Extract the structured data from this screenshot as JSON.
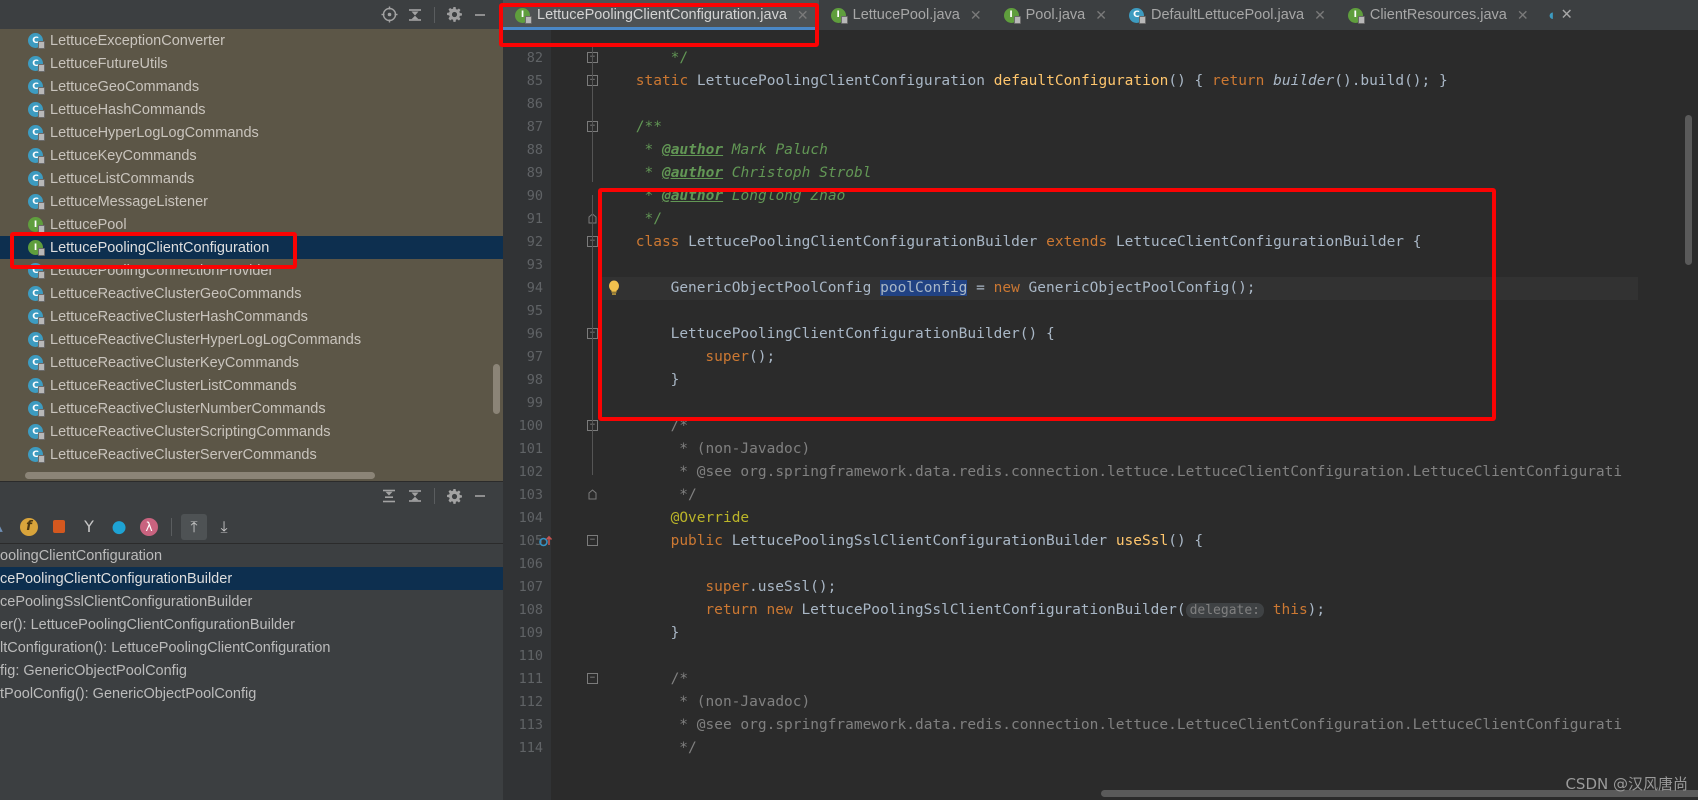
{
  "project_panel": {
    "toolbar": {
      "locate_icon": "target-icon",
      "collapse_icon": "collapse-all-icon",
      "settings_icon": "gear-icon",
      "hide_icon": "minimize-icon"
    },
    "items": [
      {
        "label": "LettuceExceptionConverter",
        "kind": "class"
      },
      {
        "label": "LettuceFutureUtils",
        "kind": "class"
      },
      {
        "label": "LettuceGeoCommands",
        "kind": "class"
      },
      {
        "label": "LettuceHashCommands",
        "kind": "class"
      },
      {
        "label": "LettuceHyperLogLogCommands",
        "kind": "class"
      },
      {
        "label": "LettuceKeyCommands",
        "kind": "class"
      },
      {
        "label": "LettuceListCommands",
        "kind": "class"
      },
      {
        "label": "LettuceMessageListener",
        "kind": "class"
      },
      {
        "label": "LettucePool",
        "kind": "interface"
      },
      {
        "label": "LettucePoolingClientConfiguration",
        "kind": "interface",
        "selected": true
      },
      {
        "label": "LettucePoolingConnectionProvider",
        "kind": "class"
      },
      {
        "label": "LettuceReactiveClusterGeoCommands",
        "kind": "class"
      },
      {
        "label": "LettuceReactiveClusterHashCommands",
        "kind": "class"
      },
      {
        "label": "LettuceReactiveClusterHyperLogLogCommands",
        "kind": "class"
      },
      {
        "label": "LettuceReactiveClusterKeyCommands",
        "kind": "class"
      },
      {
        "label": "LettuceReactiveClusterListCommands",
        "kind": "class"
      },
      {
        "label": "LettuceReactiveClusterNumberCommands",
        "kind": "class"
      },
      {
        "label": "LettuceReactiveClusterScriptingCommands",
        "kind": "class"
      },
      {
        "label": "LettuceReactiveClusterServerCommands",
        "kind": "class"
      }
    ]
  },
  "structure_panel": {
    "toolbar": {
      "expand_icon": "expand-all-icon",
      "collapse_icon": "collapse-all-icon",
      "settings_icon": "gear-icon",
      "hide_icon": "minimize-icon"
    },
    "filters": [
      {
        "name": "show-fields-icon",
        "glyph": "f",
        "active": false
      },
      {
        "name": "show-non-public-icon",
        "glyph": "■",
        "active": false
      },
      {
        "name": "sort-by-visibility-icon",
        "glyph": "Y",
        "active": false
      },
      {
        "name": "show-properties-icon",
        "glyph": "●",
        "active": false
      },
      {
        "name": "show-lambdas-icon",
        "glyph": "λ",
        "active": false
      },
      {
        "name": "expand-all-icon",
        "glyph": "⤒",
        "active": true
      },
      {
        "name": "collapse-all-icon",
        "glyph": "⤓",
        "active": false
      }
    ],
    "items": [
      {
        "label": "oolingClientConfiguration",
        "selected": false
      },
      {
        "label": "cePoolingClientConfigurationBuilder",
        "selected": true
      },
      {
        "label": "cePoolingSslClientConfigurationBuilder",
        "selected": false
      },
      {
        "label": "er(): LettucePoolingClientConfigurationBuilder",
        "selected": false
      },
      {
        "label": "ltConfiguration(): LettucePoolingClientConfiguration",
        "selected": false
      },
      {
        "label": "fig: GenericObjectPoolConfig",
        "selected": false
      },
      {
        "label": "tPoolConfig(): GenericObjectPoolConfig",
        "selected": false
      }
    ]
  },
  "editor": {
    "tabs": [
      {
        "label": "LettucePoolingClientConfiguration.java",
        "kind": "interface",
        "active": true
      },
      {
        "label": "LettucePool.java",
        "kind": "interface",
        "active": false
      },
      {
        "label": "Pool.java",
        "kind": "interface",
        "active": false
      },
      {
        "label": "DefaultLettucePool.java",
        "kind": "class",
        "active": false
      },
      {
        "label": "ClientResources.java",
        "kind": "interface",
        "active": false
      }
    ],
    "lines": [
      {
        "n": "82",
        "text": "        */",
        "fold": "minus"
      },
      {
        "n": "85",
        "text": "    static LettucePoolingClientConfiguration defaultConfiguration() { return builder().build(); }",
        "fold": "plus"
      },
      {
        "n": "86",
        "text": ""
      },
      {
        "n": "87",
        "text": "    /**",
        "fold": "minus"
      },
      {
        "n": "88",
        "text": "     * @author Mark Paluch"
      },
      {
        "n": "89",
        "text": "     * @author Christoph Strobl"
      },
      {
        "n": "90",
        "text": "     * @author Longlong Zhao"
      },
      {
        "n": "91",
        "text": "     */",
        "fold": "end"
      },
      {
        "n": "92",
        "text": "    class LettucePoolingClientConfigurationBuilder extends LettuceClientConfigurationBuilder {",
        "fold": "minus"
      },
      {
        "n": "93",
        "text": ""
      },
      {
        "n": "94",
        "text": "        GenericObjectPoolConfig poolConfig = new GenericObjectPoolConfig();",
        "bulb": true,
        "caret": true
      },
      {
        "n": "95",
        "text": ""
      },
      {
        "n": "96",
        "text": "        LettucePoolingClientConfigurationBuilder() {",
        "fold": "minus"
      },
      {
        "n": "97",
        "text": "            super();"
      },
      {
        "n": "98",
        "text": "        }"
      },
      {
        "n": "99",
        "text": ""
      },
      {
        "n": "100",
        "text": "        /*",
        "fold": "minus"
      },
      {
        "n": "101",
        "text": "         * (non-Javadoc)"
      },
      {
        "n": "102",
        "text": "         * @see org.springframework.data.redis.connection.lettuce.LettuceClientConfiguration.LettuceClientConfigurati"
      },
      {
        "n": "103",
        "text": "         */",
        "fold": "end"
      },
      {
        "n": "104",
        "text": "        @Override"
      },
      {
        "n": "105",
        "text": "        public LettucePoolingSslClientConfigurationBuilder useSsl() {",
        "fold": "minus",
        "override": true
      },
      {
        "n": "106",
        "text": ""
      },
      {
        "n": "107",
        "text": "            super.useSsl();"
      },
      {
        "n": "108",
        "text": "            return new LettucePoolingSslClientConfigurationBuilder( delegate: this);"
      },
      {
        "n": "109",
        "text": "        }"
      },
      {
        "n": "110",
        "text": ""
      },
      {
        "n": "111",
        "text": "        /*",
        "fold": "minus"
      },
      {
        "n": "112",
        "text": "         * (non-Javadoc)"
      },
      {
        "n": "113",
        "text": "         * @see org.springframework.data.redis.connection.lettuce.LettuceClientConfiguration.LettuceClientConfigurati"
      },
      {
        "n": "114",
        "text": "         */"
      }
    ],
    "inlay_hint": "delegate:",
    "selected_token": "poolConfig"
  },
  "watermark": "CSDN @汉风唐尚",
  "colors": {
    "accent_blue": "#4a88c7",
    "selection_blue": "#0d2f4f",
    "annotation_red": "#fb0303",
    "project_bg": "#5c5647",
    "editor_bg": "#2b2b2b",
    "panel_bg": "#3c3f41"
  }
}
